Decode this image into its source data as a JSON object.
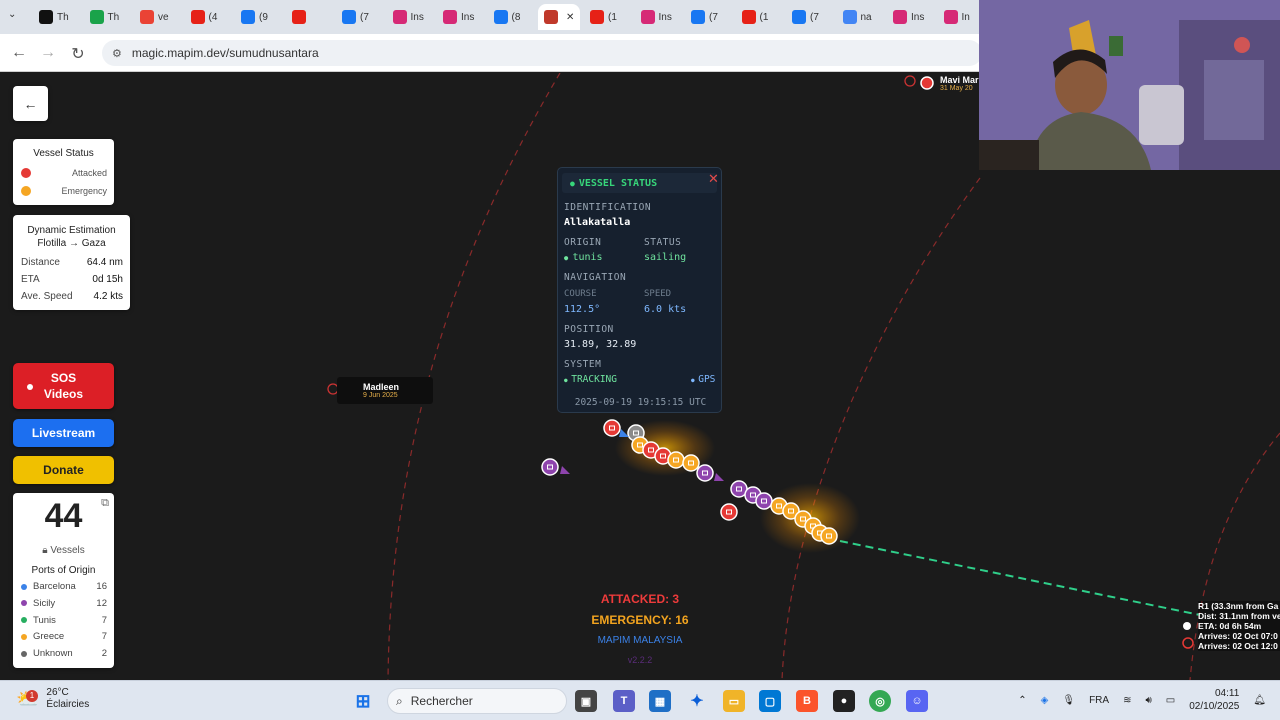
{
  "browser": {
    "tabs": [
      {
        "label": "Th",
        "icon": "x-icon",
        "color": "#111111"
      },
      {
        "label": "Th",
        "icon": "k-icon",
        "color": "#1aa34a"
      },
      {
        "label": "ve",
        "icon": "gmail-icon",
        "color": "#ea4335"
      },
      {
        "label": "(4",
        "icon": "youtube-icon",
        "color": "#e62117"
      },
      {
        "label": "(9",
        "icon": "facebook-icon",
        "color": "#1877f2"
      },
      {
        "label": "",
        "icon": "youtube-icon",
        "color": "#e62117"
      },
      {
        "label": "(7",
        "icon": "facebook-icon",
        "color": "#1877f2"
      },
      {
        "label": "Ins",
        "icon": "instagram-icon",
        "color": "#d62976"
      },
      {
        "label": "Ins",
        "icon": "instagram-icon",
        "color": "#d62976"
      },
      {
        "label": "(8",
        "icon": "facebook-icon",
        "color": "#1877f2"
      },
      {
        "label": "",
        "icon": "mapim-icon",
        "color": "#c0392b",
        "active": true
      },
      {
        "label": "(1",
        "icon": "youtube-icon",
        "color": "#e62117"
      },
      {
        "label": "Ins",
        "icon": "instagram-icon",
        "color": "#d62976"
      },
      {
        "label": "(7",
        "icon": "facebook-icon",
        "color": "#1877f2"
      },
      {
        "label": "(1",
        "icon": "youtube-icon",
        "color": "#e62117"
      },
      {
        "label": "(7",
        "icon": "facebook-icon",
        "color": "#1877f2"
      },
      {
        "label": "na",
        "icon": "google-icon",
        "color": "#4285f4"
      },
      {
        "label": "Ins",
        "icon": "instagram-icon",
        "color": "#d62976"
      },
      {
        "label": "In",
        "icon": "instagram-icon",
        "color": "#d62976"
      }
    ],
    "url": "magic.mapim.dev/sumudnusantara"
  },
  "legend": {
    "title": "Vessel Status",
    "items": [
      {
        "label": "Attacked",
        "color": "#e53935"
      },
      {
        "label": "Emergency",
        "color": "#f5a623"
      }
    ]
  },
  "estimation": {
    "title": "Dynamic Estimation",
    "subtitle": "Flotilla → Gaza",
    "rows": [
      {
        "label": "Distance",
        "value": "64.4 nm"
      },
      {
        "label": "ETA",
        "value": "0d 15h"
      },
      {
        "label": "Ave. Speed",
        "value": "4.2 kts"
      }
    ]
  },
  "buttons": {
    "sos_line1": "SOS",
    "sos_line2": "Videos",
    "livestream": "Livestream",
    "donate": "Donate"
  },
  "vessels": {
    "count": "44",
    "label": "Vessels",
    "ports_title": "Ports of Origin",
    "ports": [
      {
        "name": "Barcelona",
        "count": "16",
        "color": "#3b82e8"
      },
      {
        "name": "Sicily",
        "count": "12",
        "color": "#8e44ad"
      },
      {
        "name": "Tunis",
        "count": "7",
        "color": "#27ae60"
      },
      {
        "name": "Greece",
        "count": "7",
        "color": "#f5a623"
      },
      {
        "name": "Unknown",
        "count": "2",
        "color": "#666666"
      }
    ]
  },
  "popup": {
    "title": "VESSEL STATUS",
    "identification_label": "IDENTIFICATION",
    "identification": "Allakatalla",
    "origin_label": "ORIGIN",
    "origin": "tunis",
    "status_label": "STATUS",
    "status": "sailing",
    "navigation_label": "NAVIGATION",
    "course_label": "COURSE",
    "course": "112.5°",
    "speed_label": "SPEED",
    "speed": "6.0 kts",
    "position_label": "POSITION",
    "position": "31.89, 32.89",
    "system_label": "SYSTEM",
    "tracking": "TRACKING",
    "gps": "GPS",
    "timestamp": "2025-09-19 19:15:15 UTC"
  },
  "map": {
    "madleen": {
      "name": "Madleen",
      "date": "9 Jun 2025"
    },
    "mavi": {
      "name": "Mavi Mar",
      "date": "31 May 20"
    },
    "attacked": "ATTACKED: 3",
    "emergency": "EMERGENCY: 16",
    "brand": "MAPIM MALAYSIA",
    "version": "v2.2.2",
    "r1_lines": [
      "R1 (33.3nm from Ga",
      "Dist: 31.1nm from ve",
      "ETA: 0d 6h 54m",
      "Arrives: 02 Oct 07:0",
      "Arrives: 02 Oct 12:0"
    ]
  },
  "taskbar": {
    "temperature": "26°C",
    "weather": "Éclaircies",
    "notification": "1",
    "search": "Rechercher",
    "language": "FRA",
    "time": "04:11",
    "date": "02/10/2025"
  }
}
